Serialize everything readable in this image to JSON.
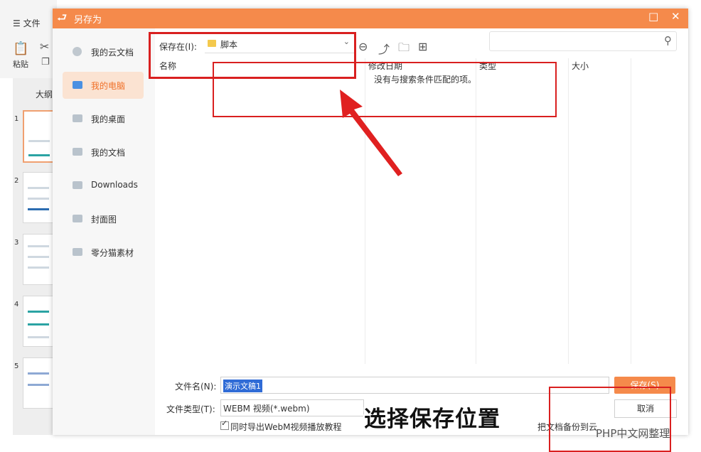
{
  "background_app": {
    "menu_file": "☰ 文件",
    "paste_label": "粘贴",
    "outline_tab": "大纲",
    "slide_numbers": [
      "1",
      "2",
      "3",
      "4",
      "5"
    ]
  },
  "dialog": {
    "title": "另存为",
    "sidebar": [
      {
        "label": "我的云文档",
        "icon": "cloud-icon"
      },
      {
        "label": "我的电脑",
        "icon": "computer-icon",
        "active": true
      },
      {
        "label": "我的桌面",
        "icon": "desktop-icon"
      },
      {
        "label": "我的文档",
        "icon": "folder-icon"
      },
      {
        "label": "Downloads",
        "icon": "folder-icon"
      },
      {
        "label": "封面图",
        "icon": "folder-icon"
      },
      {
        "label": "零分猫素材",
        "icon": "folder-icon"
      }
    ],
    "save_in_label": "保存在(I):",
    "save_in_value": "脚本",
    "columns": {
      "name": "名称",
      "date": "修改日期",
      "type": "类型",
      "size": "大小"
    },
    "empty_message": "没有与搜索条件匹配的项。",
    "filename_label": "文件名(N):",
    "filename_value": "演示文稿1",
    "filetype_label": "文件类型(T):",
    "filetype_value": "WEBM 视频(*.webm)",
    "save_button": "保存(S)",
    "cancel_button": "取消",
    "export_checkbox_label": "同时导出WebM视频播放教程",
    "export_checked": true,
    "backup_label": "把文档备份到云"
  },
  "caption": "选择保存位置",
  "watermark": "PHP中文网整理",
  "colors": {
    "accent": "#f58a4b",
    "annotation": "#d92020",
    "selection": "#2f6bd6"
  }
}
